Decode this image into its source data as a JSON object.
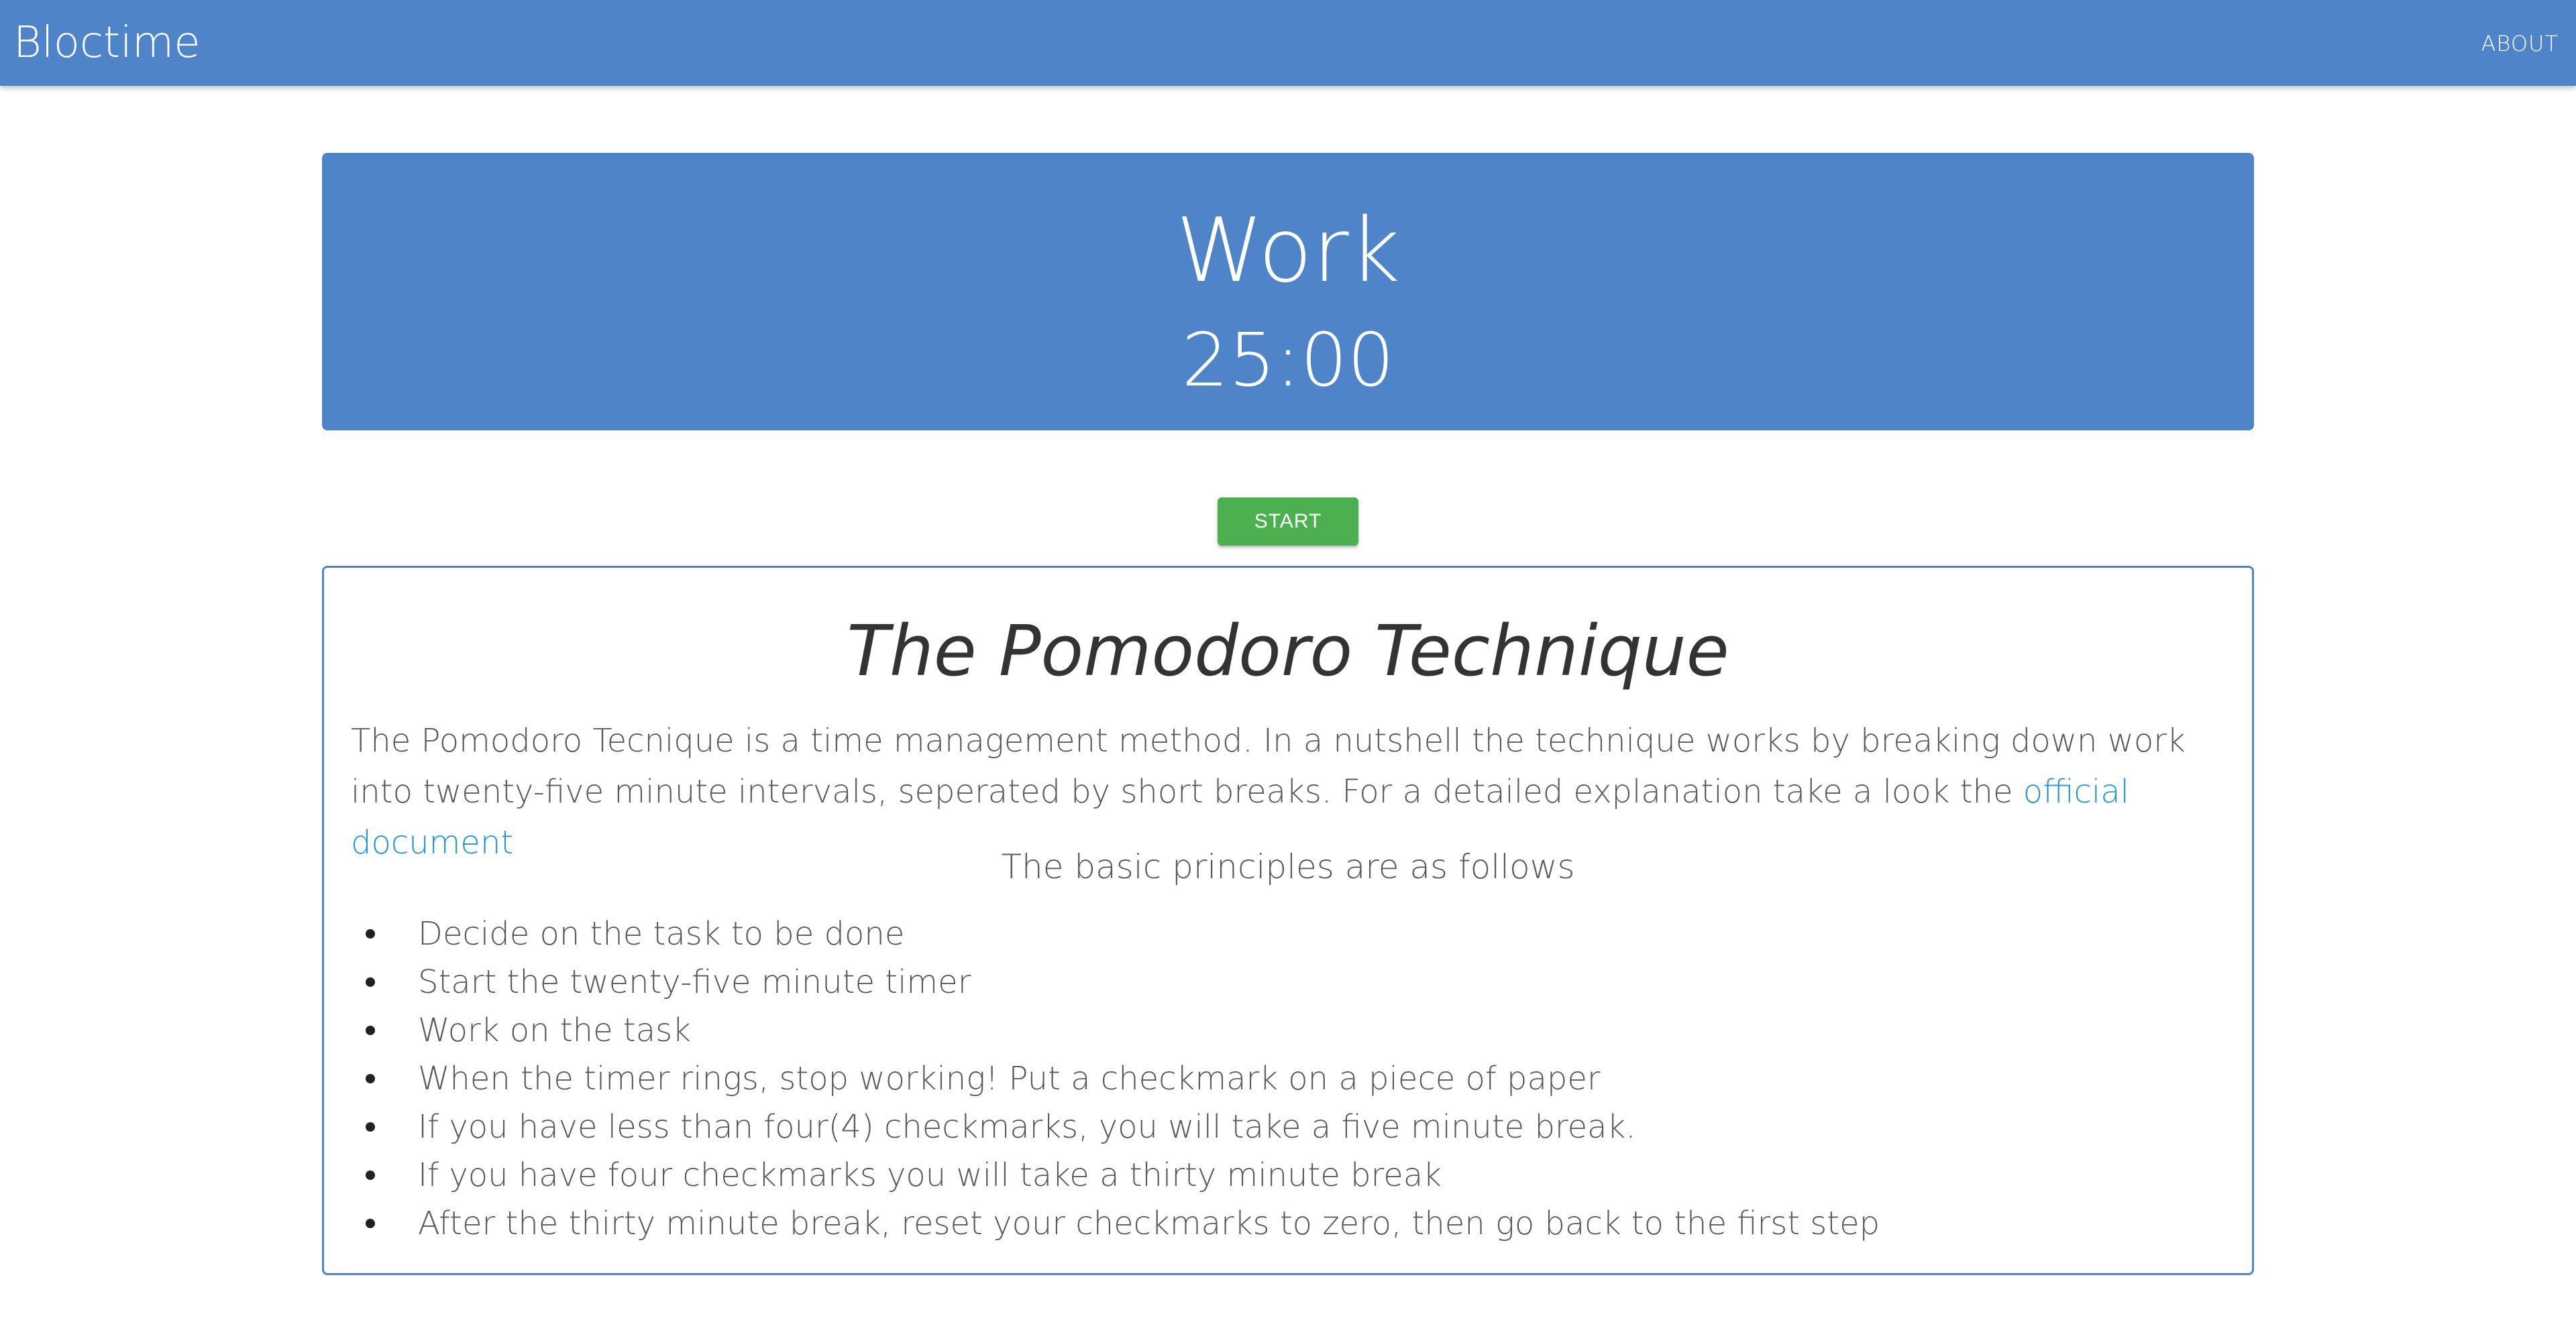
{
  "navbar": {
    "brand": "Bloctime",
    "about_label": "ABOUT"
  },
  "timer": {
    "label": "Work",
    "time": "25:00"
  },
  "controls": {
    "start_label": "START"
  },
  "info": {
    "title": "The Pomodoro Technique",
    "intro_text": "The Pomodoro Tecnique is a time management method. In a nutshell the technique works by breaking down work into twenty-five minute intervals, seperated by short breaks. For a detailed explanation take a look the ",
    "link_text": "official document",
    "principles_heading": "The basic principles are as follows",
    "principles": [
      "Decide on the task to be done",
      "Start the twenty-five minute timer",
      "Work on the task",
      "When the timer rings, stop working! Put a checkmark on a piece of paper",
      "If you have less than four(4) checkmarks, you will take a five minute break.",
      "If you have four checkmarks you will take a thirty minute break",
      "After the thirty minute break, reset your checkmarks to zero, then go back to the first step"
    ]
  },
  "colors": {
    "primary": "#5084c8",
    "start_button": "#4caf50",
    "link": "#2a95d0"
  }
}
